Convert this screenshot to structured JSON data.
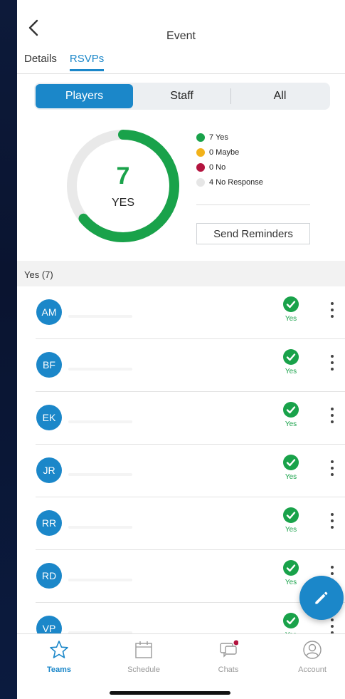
{
  "header": {
    "title": "Event"
  },
  "tabs": [
    {
      "label": "Details",
      "active": false
    },
    {
      "label": "RSVPs",
      "active": true
    }
  ],
  "segments": [
    {
      "label": "Players",
      "active": true
    },
    {
      "label": "Staff",
      "active": false
    },
    {
      "label": "All",
      "active": false
    }
  ],
  "summary": {
    "count": "7",
    "label": "YES",
    "yes_fraction": 0.64
  },
  "legend": [
    {
      "label": "7 Yes",
      "color": "#19a24a"
    },
    {
      "label": "0 Maybe",
      "color": "#f2b21a"
    },
    {
      "label": "0 No",
      "color": "#b3143f"
    },
    {
      "label": "4 No Response",
      "color": "#e6e6e6"
    }
  ],
  "send_reminders": "Send Reminders",
  "section_title": "Yes (7)",
  "members": [
    {
      "initials": "AM",
      "status": "Yes"
    },
    {
      "initials": "BF",
      "status": "Yes"
    },
    {
      "initials": "EK",
      "status": "Yes"
    },
    {
      "initials": "JR",
      "status": "Yes"
    },
    {
      "initials": "RR",
      "status": "Yes"
    },
    {
      "initials": "RD",
      "status": "Yes"
    },
    {
      "initials": "VP",
      "status": "Yes"
    }
  ],
  "nav": [
    {
      "label": "Teams",
      "icon": "star-icon",
      "active": true
    },
    {
      "label": "Schedule",
      "icon": "calendar-icon",
      "active": false
    },
    {
      "label": "Chats",
      "icon": "chat-icon",
      "active": false
    },
    {
      "label": "Account",
      "icon": "account-icon",
      "active": false
    }
  ],
  "colors": {
    "accent": "#1b87c9",
    "yes": "#19a24a",
    "notification": "#b3143f"
  }
}
